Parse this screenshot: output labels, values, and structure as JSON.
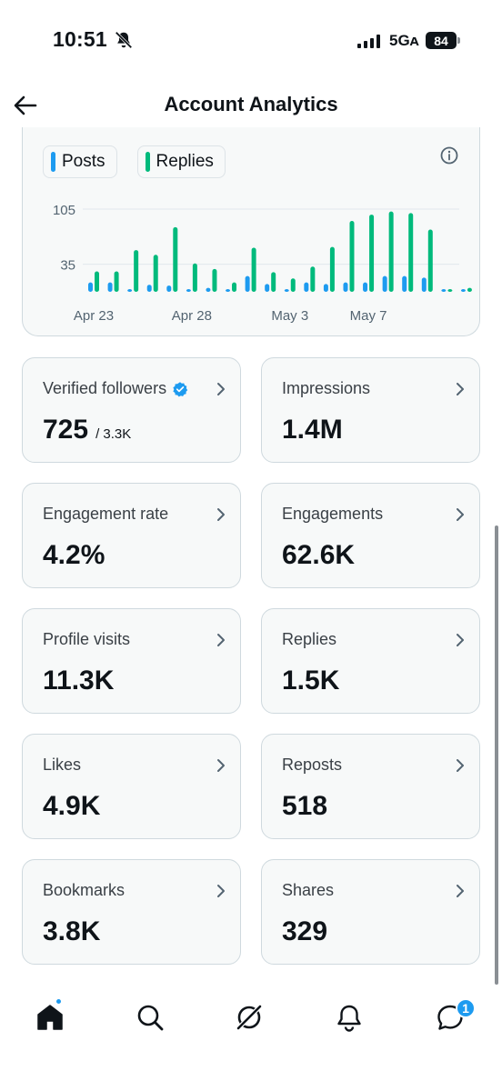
{
  "status_bar": {
    "time": "10:51",
    "network": "5Gᴀ",
    "battery": "84",
    "icons": [
      "bell-off-icon",
      "signal-icon",
      "battery-icon"
    ]
  },
  "header": {
    "title": "Account Analytics",
    "back_icon": "back-arrow-icon"
  },
  "colors": {
    "posts": "#1d9bf0",
    "replies": "#00ba7c",
    "accent": "#1d9bf0",
    "card_bg": "#f7f9f9",
    "card_border": "#cfd9de"
  },
  "legend": {
    "posts_label": "Posts",
    "replies_label": "Replies",
    "info_icon": "info-icon"
  },
  "chart_data": {
    "type": "bar",
    "categories": [
      "Apr 23",
      "Apr 24",
      "Apr 25",
      "Apr 26",
      "Apr 27",
      "Apr 28",
      "Apr 29",
      "Apr 30",
      "May 1",
      "May 2",
      "May 3",
      "May 4",
      "May 5",
      "May 6",
      "May 7",
      "May 8",
      "May 9",
      "May 10",
      "May 11",
      "May 12"
    ],
    "x_tick_labels": [
      "Apr 23",
      "Apr 28",
      "May 3",
      "May 7"
    ],
    "y_tick_labels": [
      "105",
      "35"
    ],
    "ylim": [
      0,
      105
    ],
    "grid": true,
    "series": [
      {
        "name": "Posts",
        "values": [
          12,
          12,
          2,
          9,
          8,
          3,
          5,
          2,
          20,
          10,
          2,
          12,
          10,
          12,
          12,
          20,
          20,
          18,
          2,
          0
        ]
      },
      {
        "name": "Replies",
        "values": [
          26,
          26,
          53,
          47,
          82,
          36,
          29,
          12,
          56,
          25,
          17,
          32,
          57,
          90,
          98,
          102,
          100,
          79,
          2,
          5
        ]
      }
    ]
  },
  "metrics": [
    {
      "label": "Verified followers",
      "value": "725",
      "sub": "/ 3.3K",
      "verified": true
    },
    {
      "label": "Impressions",
      "value": "1.4M",
      "sub": ""
    },
    {
      "label": "Engagement rate",
      "value": "4.2%",
      "sub": ""
    },
    {
      "label": "Engagements",
      "value": "62.6K",
      "sub": ""
    },
    {
      "label": "Profile visits",
      "value": "11.3K",
      "sub": ""
    },
    {
      "label": "Replies",
      "value": "1.5K",
      "sub": ""
    },
    {
      "label": "Likes",
      "value": "4.9K",
      "sub": ""
    },
    {
      "label": "Reposts",
      "value": "518",
      "sub": ""
    },
    {
      "label": "Bookmarks",
      "value": "3.8K",
      "sub": ""
    },
    {
      "label": "Shares",
      "value": "329",
      "sub": ""
    }
  ],
  "bottom_nav": {
    "items": [
      "home-icon",
      "search-icon",
      "grok-icon",
      "notifications-icon",
      "messages-icon"
    ],
    "messages_badge": "1"
  }
}
